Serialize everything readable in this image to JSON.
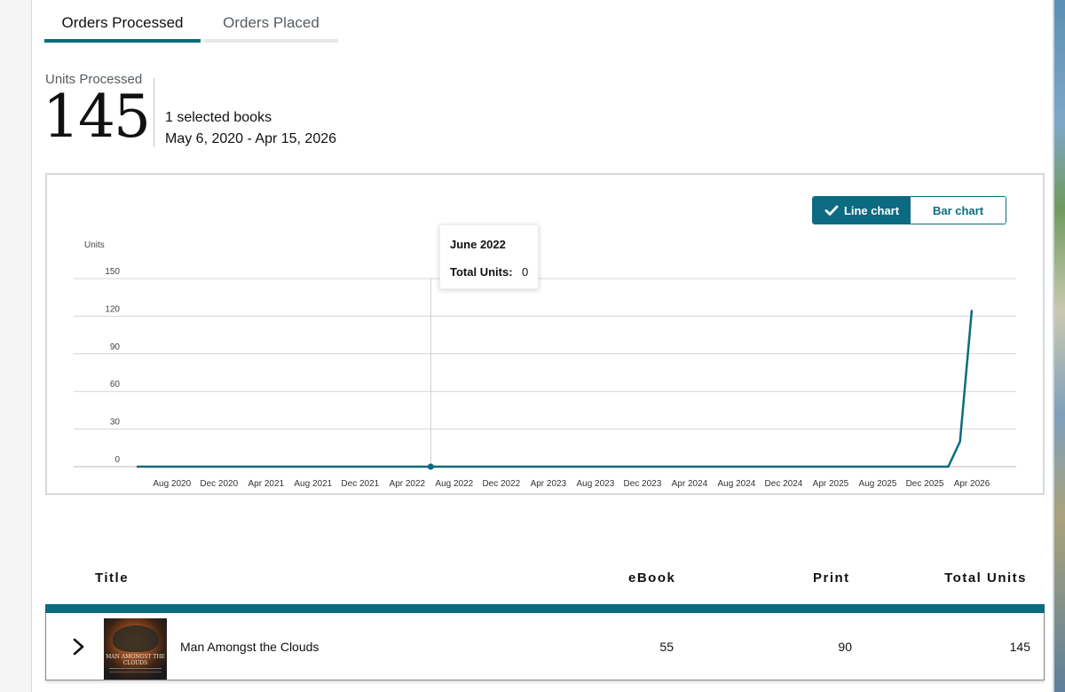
{
  "tabs": [
    {
      "label": "Orders Processed",
      "active": true
    },
    {
      "label": "Orders Placed",
      "active": false
    }
  ],
  "summary": {
    "units_label": "Units Processed",
    "units_value": "145",
    "selected_books": "1 selected books",
    "date_range": "May 6, 2020 - Apr 15, 2026"
  },
  "chart_toggle": {
    "line_label": "Line chart",
    "bar_label": "Bar chart",
    "selected": "line"
  },
  "tooltip": {
    "title": "June 2022",
    "label": "Total Units:",
    "value": "0"
  },
  "chart_data": {
    "type": "line",
    "ylabel": "Units",
    "ylim": [
      0,
      150
    ],
    "yticks": [
      0,
      30,
      60,
      90,
      120,
      150
    ],
    "x_tick_labels": [
      "Aug 2020",
      "Dec 2020",
      "Apr 2021",
      "Aug 2021",
      "Dec 2021",
      "Apr 2022",
      "Aug 2022",
      "Dec 2022",
      "Apr 2023",
      "Aug 2023",
      "Dec 2023",
      "Apr 2024",
      "Aug 2024",
      "Dec 2024",
      "Apr 2025",
      "Aug 2025",
      "Dec 2025",
      "Apr 2026"
    ],
    "x_range": [
      "2020-05",
      "2026-04"
    ],
    "grid": true,
    "series": [
      {
        "color": "#0c6b80",
        "points": [
          {
            "x": "2020-05",
            "y": 0
          },
          {
            "x": "2022-06",
            "y": 0
          },
          {
            "x": "2026-02",
            "y": 0
          },
          {
            "x": "2026-03",
            "y": 20
          },
          {
            "x": "2026-04",
            "y": 125
          }
        ]
      }
    ],
    "highlight": {
      "x": "2022-06",
      "y": 0
    }
  },
  "table": {
    "headers": {
      "title": "Title",
      "ebook": "eBook",
      "print": "Print",
      "total": "Total Units"
    },
    "rows": [
      {
        "title": "Man Amongst the Clouds",
        "ebook": "55",
        "print": "90",
        "total": "145",
        "cover_text": "MAN AMONGST THE CLOUDS"
      }
    ]
  },
  "colors": {
    "accent": "#0c6b80",
    "grid": "#d5d5d5"
  }
}
